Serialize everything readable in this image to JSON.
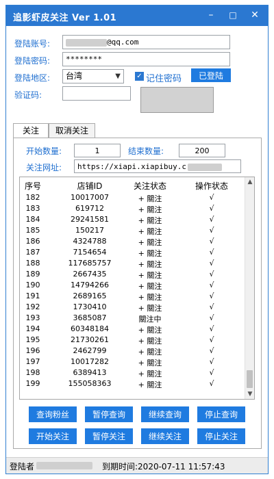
{
  "window": {
    "title": "追影虾皮关注 Ver 1.01",
    "minimize_glyph": "–",
    "maximize_glyph": "□",
    "close_glyph": "✕"
  },
  "login": {
    "account_label": "登陆账号:",
    "account_value": "@qq.com",
    "password_label": "登陆密码:",
    "password_value": "********",
    "region_label": "登陆地区:",
    "region_value": "台湾",
    "remember_label": "记住密码",
    "remember_checked": true,
    "login_button": "已登陆",
    "captcha_label": "验证码:",
    "captcha_value": ""
  },
  "tabs": [
    {
      "label": "关注",
      "active": true
    },
    {
      "label": "取消关注",
      "active": false
    }
  ],
  "follow": {
    "start_label": "开始数量:",
    "start_value": "1",
    "end_label": "结束数量:",
    "end_value": "200",
    "url_label": "关注网址:",
    "url_value": "https://xiapi.xiapibuy.c"
  },
  "table": {
    "columns": [
      "序号",
      "店铺ID",
      "关注状态",
      "操作状态"
    ],
    "rows": [
      [
        "182",
        "10017007",
        "+ 關注",
        "√"
      ],
      [
        "183",
        "619712",
        "+ 關注",
        "√"
      ],
      [
        "184",
        "29241581",
        "+ 關注",
        "√"
      ],
      [
        "185",
        "150217",
        "+ 關注",
        "√"
      ],
      [
        "186",
        "4324788",
        "+ 關注",
        "√"
      ],
      [
        "187",
        "7154654",
        "+ 關注",
        "√"
      ],
      [
        "188",
        "117685757",
        "+ 關注",
        "√"
      ],
      [
        "189",
        "2667435",
        "+ 關注",
        "√"
      ],
      [
        "190",
        "14794266",
        "+ 關注",
        "√"
      ],
      [
        "191",
        "2689165",
        "+ 關注",
        "√"
      ],
      [
        "192",
        "1730410",
        "+ 關注",
        "√"
      ],
      [
        "193",
        "3685087",
        "關注中",
        "√"
      ],
      [
        "194",
        "60348184",
        "+ 關注",
        "√"
      ],
      [
        "195",
        "21730261",
        "+ 關注",
        "√"
      ],
      [
        "196",
        "2462799",
        "+ 關注",
        "√"
      ],
      [
        "197",
        "10017282",
        "+ 關注",
        "√"
      ],
      [
        "198",
        "6389413",
        "+ 關注",
        "√"
      ],
      [
        "199",
        "155058363",
        "+ 關注",
        "√"
      ]
    ],
    "scroll_up_glyph": "▲",
    "scroll_down_glyph": "▼"
  },
  "buttons": {
    "query_fans": "查询粉丝",
    "pause_query": "暂停查询",
    "continue_query": "继续查询",
    "stop_query": "停止查询",
    "start_follow": "开始关注",
    "pause_follow": "暂停关注",
    "continue_follow": "继续关注",
    "stop_follow": "停止关注"
  },
  "status": {
    "user_label": "登陆者",
    "expiry": "到期时间:2020-07-11 11:57:43"
  },
  "colors": {
    "accent": "#2b78d1",
    "button": "#1f7be0",
    "label": "#1f6fd0"
  }
}
